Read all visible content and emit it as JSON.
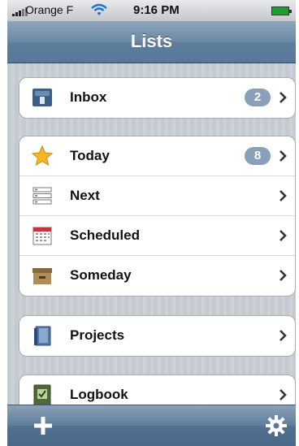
{
  "status": {
    "carrier": "Orange F",
    "time": "9:16 PM"
  },
  "nav": {
    "title": "Lists"
  },
  "groups": [
    {
      "rows": [
        {
          "label": "Inbox",
          "badge": "2",
          "icon": "inbox-icon"
        }
      ]
    },
    {
      "rows": [
        {
          "label": "Today",
          "badge": "8",
          "icon": "star-icon"
        },
        {
          "label": "Next",
          "icon": "list-icon"
        },
        {
          "label": "Scheduled",
          "icon": "calendar-icon"
        },
        {
          "label": "Someday",
          "icon": "archive-box-icon"
        }
      ]
    },
    {
      "rows": [
        {
          "label": "Projects",
          "icon": "projects-icon"
        }
      ]
    },
    {
      "rows": [
        {
          "label": "Logbook",
          "icon": "logbook-icon"
        }
      ]
    }
  ],
  "toolbar": {
    "left": "plus-icon",
    "right": "gear-icon"
  },
  "colors": {
    "nav": "#6a87a3",
    "badge": "#8a9fba"
  }
}
